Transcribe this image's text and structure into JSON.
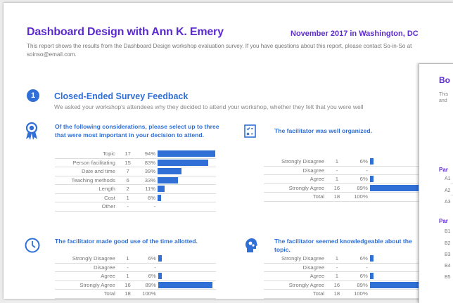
{
  "header": {
    "title": "Dashboard Design with Ann K. Emery",
    "subtitle": "November 2017 in Washington, DC",
    "intro": "This report shows the results from the Dashboard Design workshop evaluation survey. If you have questions about this report, please contact So-in-So at soinso@email.com."
  },
  "section": {
    "number": "1",
    "title": "Closed-Ended Survey Feedback",
    "description": "We asked your workshop's attendees why they decided to attend your workshop, whether they felt that you were well"
  },
  "questions": [
    {
      "title": "Of the following considerations, please select up to three that were most important in your decision to attend.",
      "icon": "ribbon-icon",
      "rows": [
        {
          "label": "Topic",
          "count": "17",
          "pct": "94%",
          "value": 94
        },
        {
          "label": "Person facilitating",
          "count": "15",
          "pct": "83%",
          "value": 83
        },
        {
          "label": "Date and time",
          "count": "7",
          "pct": "39%",
          "value": 39
        },
        {
          "label": "Teaching methods",
          "count": "6",
          "pct": "33%",
          "value": 33
        },
        {
          "label": "Length",
          "count": "2",
          "pct": "11%",
          "value": 11
        },
        {
          "label": "Cost",
          "count": "1",
          "pct": "6%",
          "value": 6
        },
        {
          "label": "Other",
          "count": "-",
          "pct": "-",
          "value": 0
        }
      ]
    },
    {
      "title": "The facilitator was well organized.",
      "icon": "checklist-icon",
      "rows": [
        {
          "label": "Strongly Disagree",
          "count": "1",
          "pct": "6%",
          "value": 6
        },
        {
          "label": "Disagree",
          "count": "-",
          "pct": "-",
          "value": 0
        },
        {
          "label": "Agree",
          "count": "1",
          "pct": "6%",
          "value": 6
        },
        {
          "label": "Strongly Agree",
          "count": "16",
          "pct": "89%",
          "value": 89
        },
        {
          "label": "Total",
          "count": "18",
          "pct": "100%",
          "value": 0
        }
      ]
    },
    {
      "title": "The facilitator made good use of the time allotted.",
      "icon": "clock-icon",
      "rows": [
        {
          "label": "Strongly Disagree",
          "count": "1",
          "pct": "6%",
          "value": 6
        },
        {
          "label": "Disagree",
          "count": "-",
          "pct": "-",
          "value": 0
        },
        {
          "label": "Agree",
          "count": "1",
          "pct": "6%",
          "value": 6
        },
        {
          "label": "Strongly Agree",
          "count": "16",
          "pct": "89%",
          "value": 89
        },
        {
          "label": "Total",
          "count": "18",
          "pct": "100%",
          "value": 0
        }
      ]
    },
    {
      "title": "The facilitator seemed knowledgeable about the topic.",
      "icon": "head-gears-icon",
      "rows": [
        {
          "label": "Strongly Disagree",
          "count": "1",
          "pct": "6%",
          "value": 6
        },
        {
          "label": "Disagree",
          "count": "-",
          "pct": "-",
          "value": 0
        },
        {
          "label": "Agree",
          "count": "1",
          "pct": "6%",
          "value": 6
        },
        {
          "label": "Strongly Agree",
          "count": "16",
          "pct": "89%",
          "value": 89
        },
        {
          "label": "Total",
          "count": "18",
          "pct": "100%",
          "value": 0
        }
      ]
    }
  ],
  "second_page": {
    "title": "Bo",
    "text_lines": [
      "This",
      "and"
    ],
    "part_a": "Par",
    "items_a": [
      "A1",
      "A2",
      "A3"
    ],
    "part_b": "Par",
    "items_b": [
      "B1",
      "B2",
      "B3",
      "B4",
      "B5"
    ]
  },
  "colors": {
    "accent_purple": "#5b2bd0",
    "accent_blue": "#2f6fd6"
  }
}
